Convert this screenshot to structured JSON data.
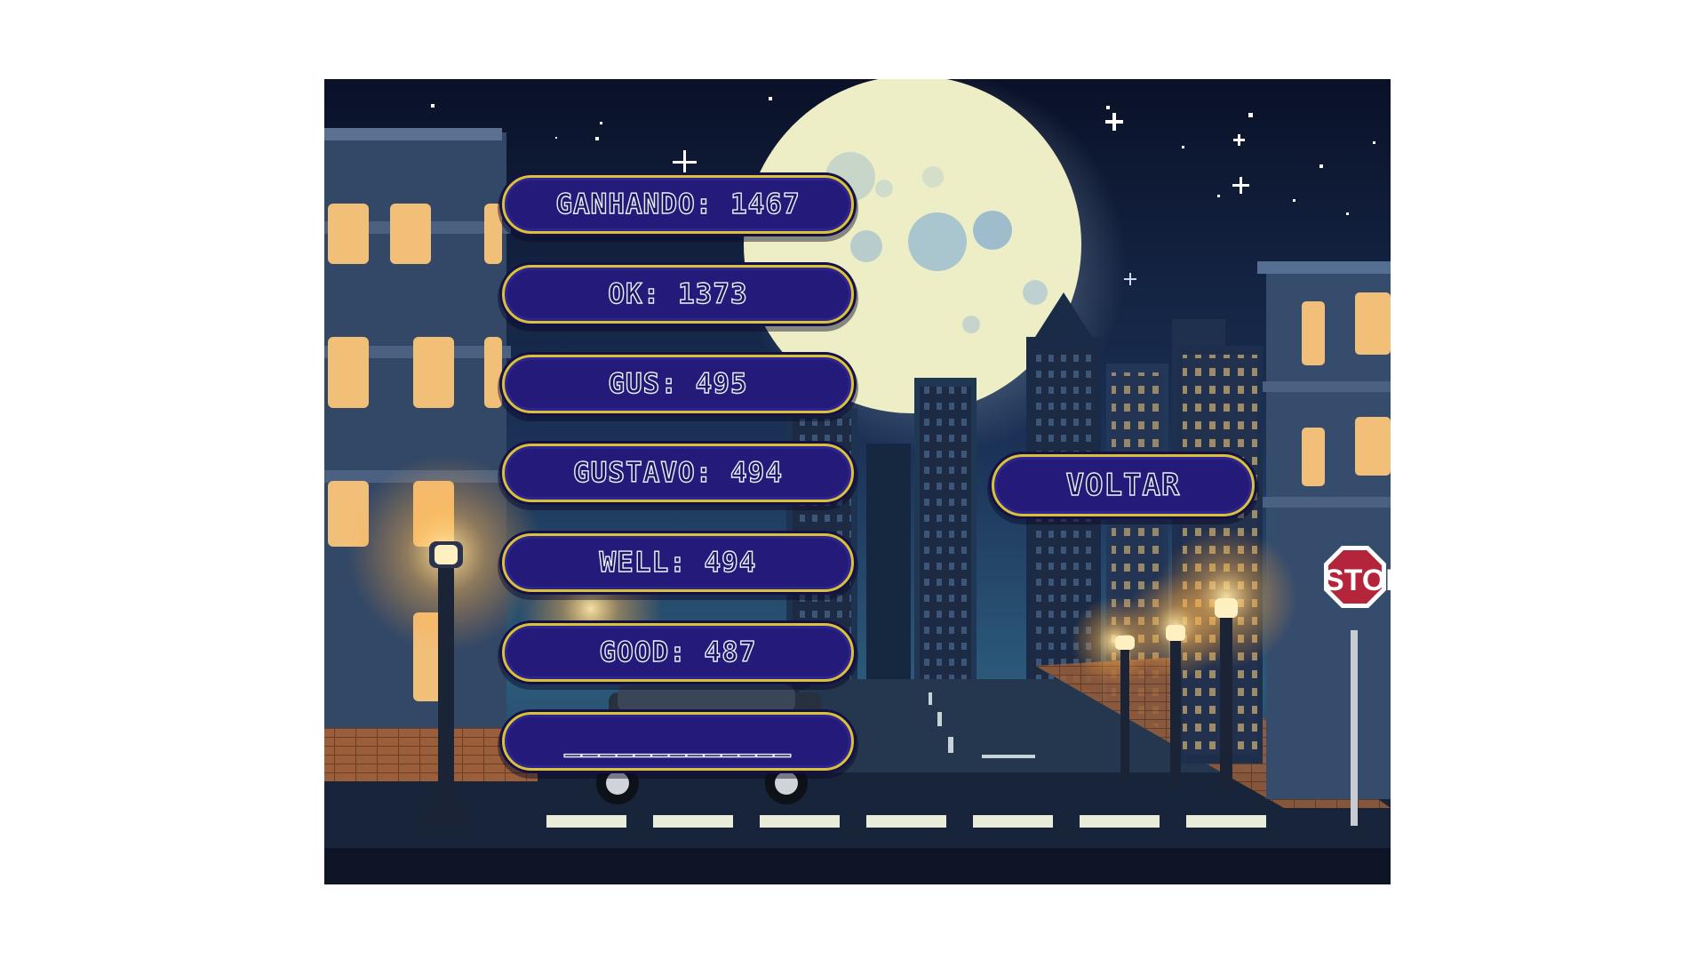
{
  "leaderboard": {
    "entries": [
      {
        "label": "GANHANDO: 1467"
      },
      {
        "label": "OK: 1373"
      },
      {
        "label": "GUS: 495"
      },
      {
        "label": "GUSTAVO: 494"
      },
      {
        "label": "WELL: 494"
      },
      {
        "label": "GOOD: 487"
      },
      {
        "label": "_____________"
      }
    ]
  },
  "navigation": {
    "back_label": "VOLTAR"
  },
  "scene": {
    "stop_sign_text": "STOP"
  },
  "colors": {
    "button_fill": "#241a7a",
    "button_border": "#d9c236",
    "button_text_outline": "#e9ecff",
    "sky": "#0b1530",
    "moon": "#eeeec6"
  }
}
